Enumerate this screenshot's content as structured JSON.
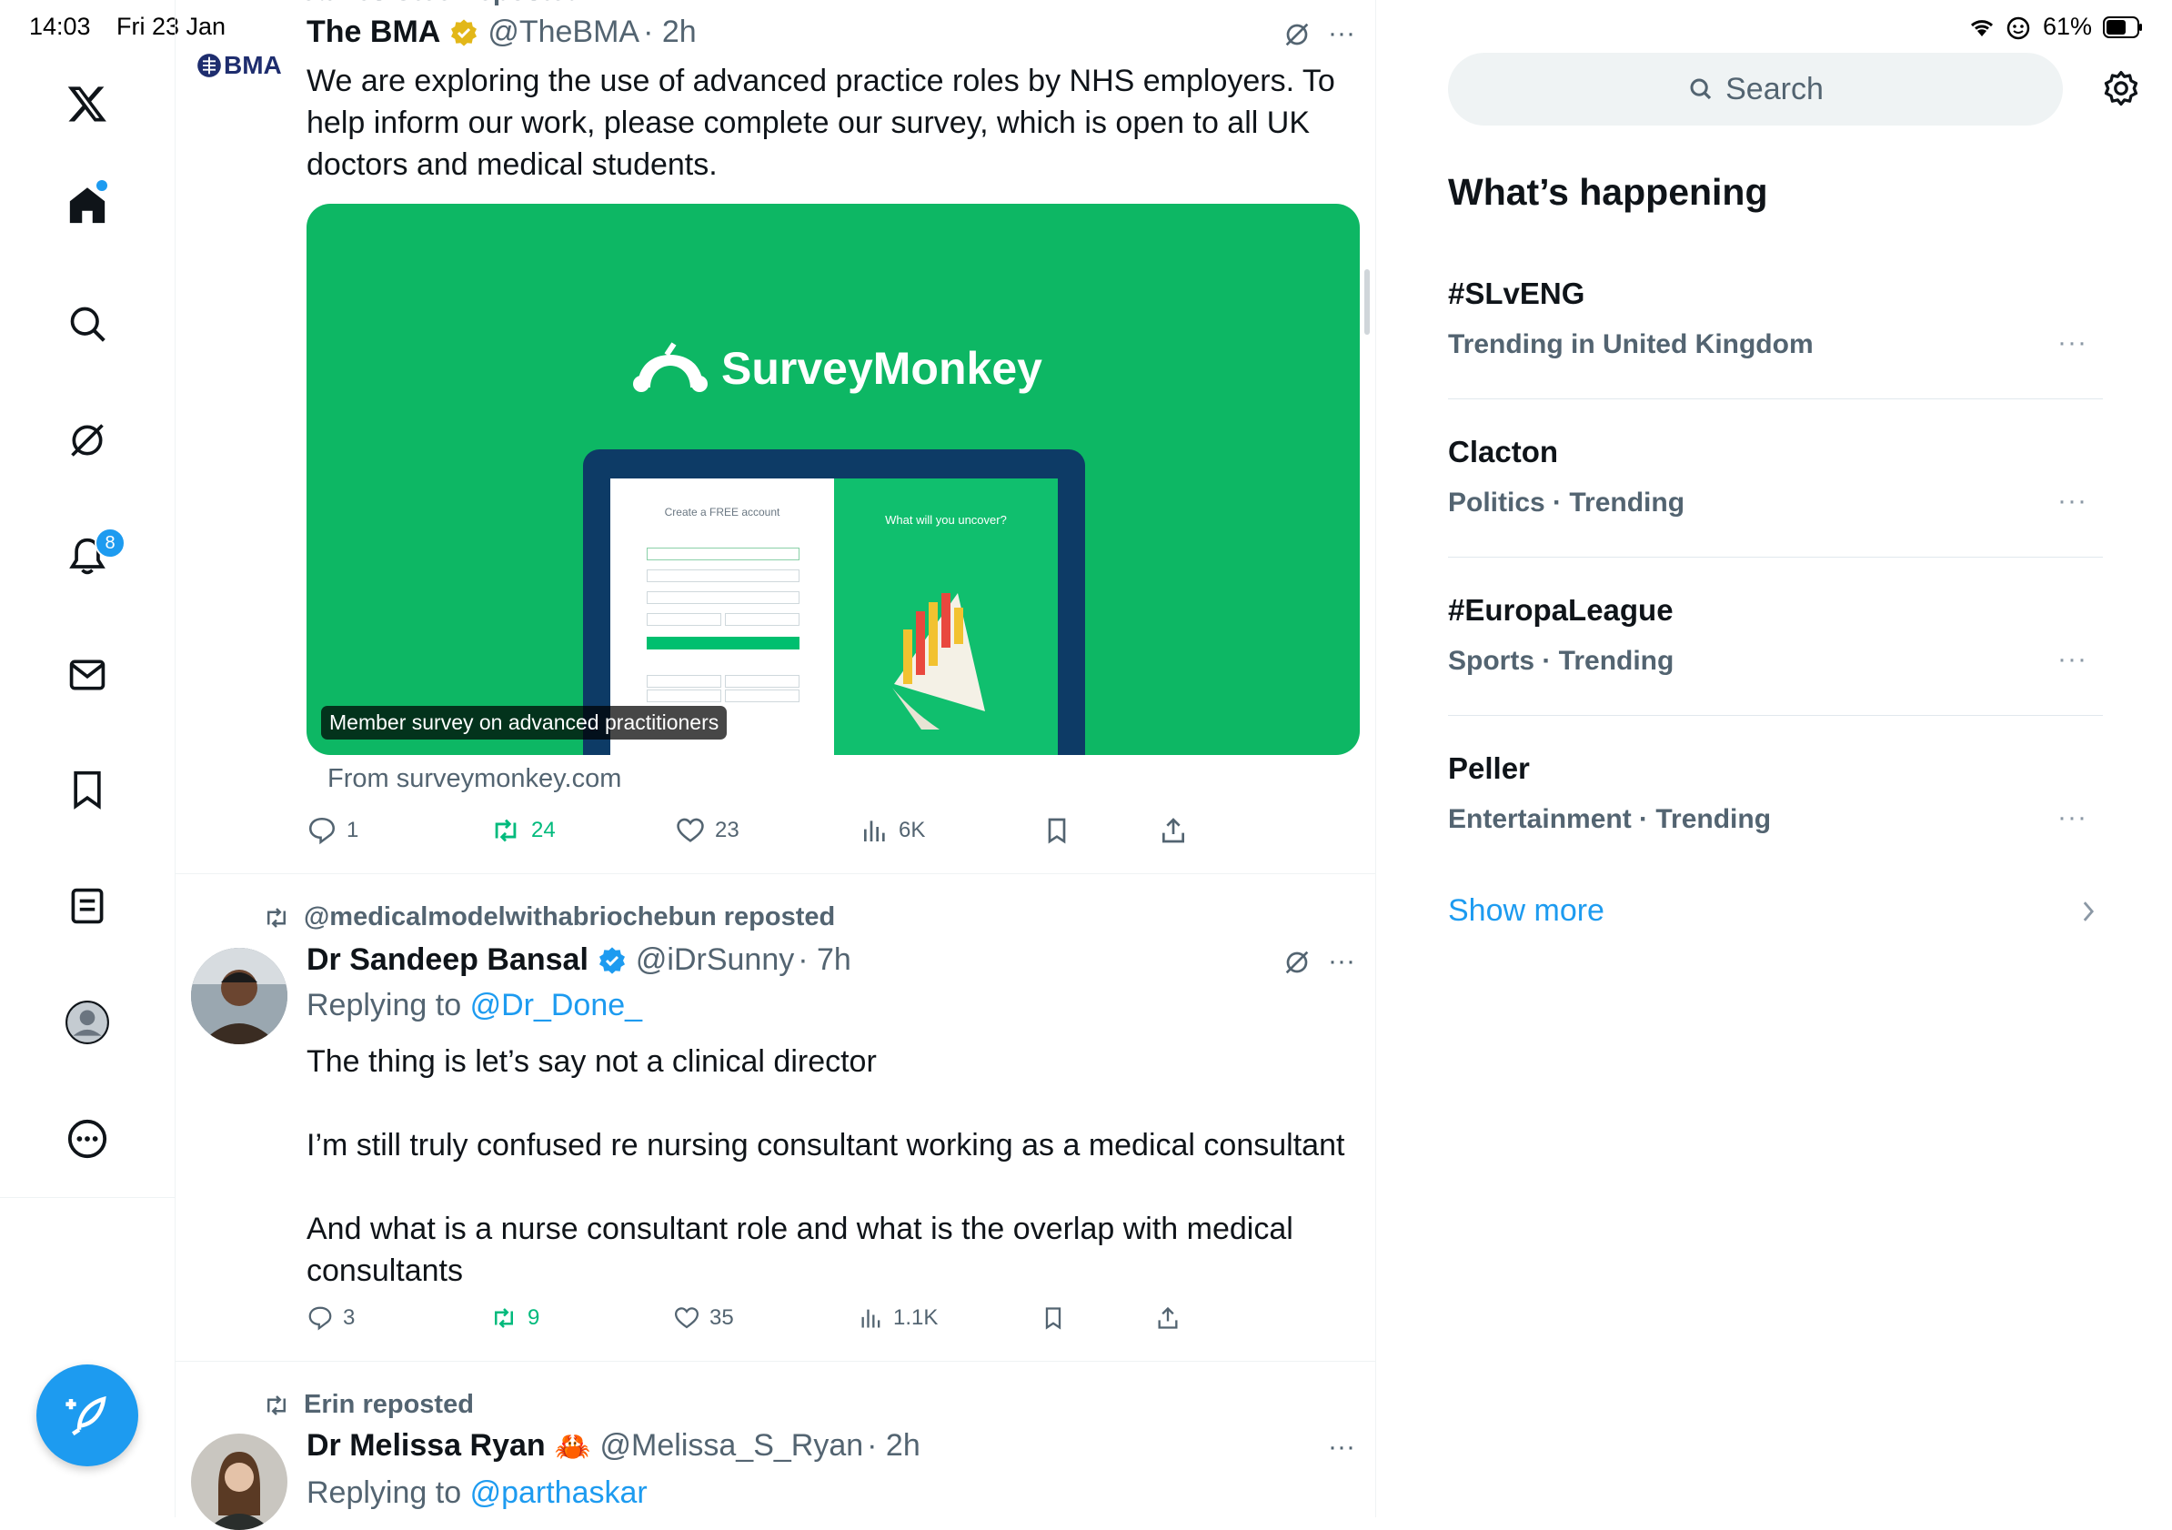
{
  "status_bar": {
    "time": "14:03",
    "date": "Fri 23 Jan",
    "battery": "61%"
  },
  "nav": {
    "notifications_badge": "8"
  },
  "feed": {
    "top_partial_text": "Dr James Steel reposted",
    "tweet1": {
      "avatar_text": "BMA",
      "name": "The BMA",
      "handle": "@TheBMA",
      "time": "· 2h",
      "text_lines": [
        "We are exploring the use of advanced practice roles by NHS employers. To",
        "help inform our work, please complete our survey, which is open to all UK",
        "doctors and medical students."
      ],
      "card": {
        "brand": "SurveyMonkey",
        "laptop_left_title": "Create a FREE account",
        "laptop_right_title": "What will you uncover?",
        "caption": "Member survey on advanced practitioners",
        "source": "From surveymonkey.com"
      },
      "replies": "1",
      "reposts": "24",
      "likes": "23",
      "views": "6K"
    },
    "tweet2": {
      "repost_by": "@medicalmodelwithabriochebun reposted",
      "name": "Dr Sandeep Bansal",
      "handle": "@iDrSunny",
      "time": "· 7h",
      "replying_prefix": "Replying to",
      "replying_to": "@Dr_Done_",
      "paragraphs": [
        "The thing is let’s say not a clinical director",
        "I’m still truly confused re nursing consultant working as a medical consultant",
        "And what is a nurse consultant role and what is the overlap with medical",
        "consultants"
      ],
      "replies": "3",
      "reposts": "9",
      "likes": "35",
      "views": "1.1K"
    },
    "tweet3": {
      "repost_by": "Erin reposted",
      "name": "Dr Melissa Ryan",
      "emoji": "🦀",
      "handle": "@Melissa_S_Ryan",
      "time": "· 2h",
      "replying_prefix": "Replying to",
      "replying_to": "@parthaskar"
    }
  },
  "sidebar": {
    "search_placeholder": "Search",
    "section_title": "What’s happening",
    "trends": [
      {
        "title": "#SLvENG",
        "subtitle": "Trending in United Kingdom"
      },
      {
        "title": "Clacton",
        "subtitle": "Politics · Trending"
      },
      {
        "title": "#EuropaLeague",
        "subtitle": "Sports · Trending"
      },
      {
        "title": "Peller",
        "subtitle": "Entertainment · Trending"
      }
    ],
    "show_more": "Show more"
  },
  "colors": {
    "accent": "#1d9bf0",
    "repost_green": "#00ba7c",
    "card_green": "#0db764",
    "text": "#0f1419",
    "muted": "#536471"
  }
}
